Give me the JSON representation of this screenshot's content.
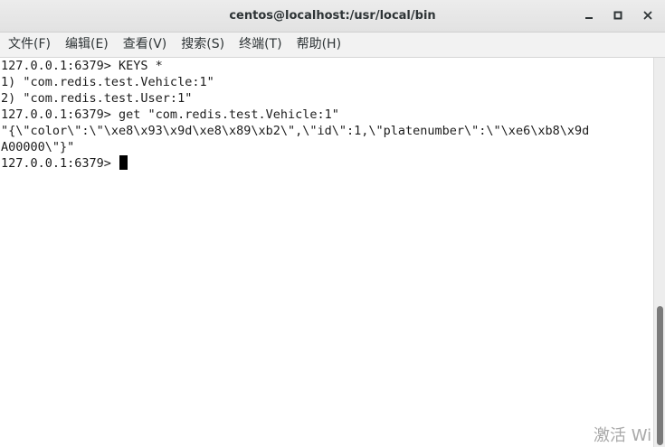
{
  "window": {
    "title": "centos@localhost:/usr/local/bin"
  },
  "menu": {
    "items": [
      {
        "label": "文件(F)"
      },
      {
        "label": "编辑(E)"
      },
      {
        "label": "查看(V)"
      },
      {
        "label": "搜索(S)"
      },
      {
        "label": "终端(T)"
      },
      {
        "label": "帮助(H)"
      }
    ]
  },
  "terminal": {
    "lines": [
      "127.0.0.1:6379> KEYS *",
      "1) \"com.redis.test.Vehicle:1\"",
      "2) \"com.redis.test.User:1\"",
      "127.0.0.1:6379> get \"com.redis.test.Vehicle:1\"",
      "\"{\\\"color\\\":\\\"\\xe8\\x93\\x9d\\xe8\\x89\\xb2\\\",\\\"id\\\":1,\\\"platenumber\\\":\\\"\\xe6\\xb8\\x9d",
      "A00000\\\"}\"",
      "127.0.0.1:6379> "
    ]
  },
  "watermark": {
    "text": "激活 Wi"
  },
  "icons": {
    "minimize": "minimize-icon",
    "maximize": "maximize-icon",
    "close": "close-icon"
  },
  "colors": {
    "terminal_bg": "#ffffff",
    "terminal_fg": "#1c1c1c",
    "titlebar_bg": "#e6e6e6"
  }
}
